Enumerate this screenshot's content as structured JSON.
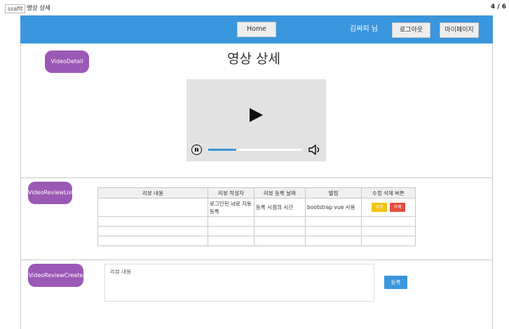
{
  "slide": {
    "tag": "ssafit",
    "title": "영상 상세",
    "page_number": "4 / 6"
  },
  "header": {
    "home_label": "Home",
    "user_text": "김싸피 님",
    "logout_label": "로그아웃",
    "mypage_label": "마이페이지"
  },
  "video_detail": {
    "component_label": "VideoDetail",
    "title": "영상 상세",
    "player": {
      "progress_percent": 30,
      "play_icon": "play-icon",
      "pause_icon": "pause-icon",
      "volume_icon": "volume-icon"
    }
  },
  "review_list": {
    "component_label": "VideoReviewList",
    "columns": [
      "리뷰 내용",
      "리뷰 작성자",
      "리뷰 등록 날짜",
      "별점",
      "수정 삭제 버튼"
    ],
    "rows": [
      {
        "content": "",
        "author": "로그인된 id로 자동 등록",
        "date": "등록 시점의 시간",
        "rating": "bootstrap vue 사용",
        "edit_label": "수정",
        "delete_label": "삭제"
      }
    ]
  },
  "review_create": {
    "component_label": "VideoReviewCreate",
    "placeholder": "리뷰 내용",
    "submit_label": "등록"
  },
  "colors": {
    "header": "#3a96dd",
    "component_label": "#9b59b6",
    "edit_button": "#f1c40f",
    "delete_button": "#e74c3c",
    "submit_button": "#3a96dd"
  }
}
